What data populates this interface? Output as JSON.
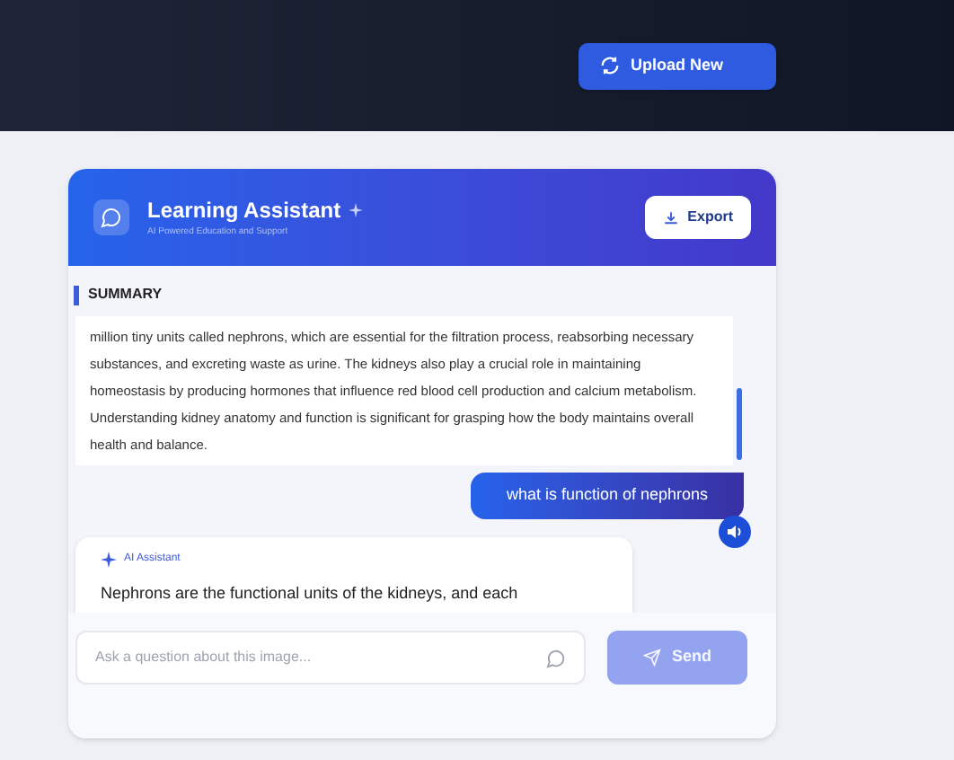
{
  "top_bar": {
    "upload_button": "Upload New"
  },
  "assistant": {
    "title": "Learning Assistant",
    "subtitle": "AI Powered Education and Support",
    "export_button": "Export"
  },
  "summary": {
    "heading": "SUMMARY",
    "text": "million tiny units called nephrons, which are essential for the filtration process, reabsorbing necessary substances, and excreting waste as urine. The kidneys also play a crucial role in maintaining homeostasis by producing hormones that influence red blood cell production and calcium metabolism. Understanding kidney anatomy and function is significant for grasping how the body maintains overall health and balance."
  },
  "messages": [
    {
      "kind": "user",
      "text": "what is function of nephrons"
    },
    {
      "kind": "assistant",
      "sender": "AI Assistant",
      "text": "Nephrons are the functional units of the kidneys, and each"
    }
  ],
  "composer": {
    "placeholder": "Ask a question about this image...",
    "send_button": "Send",
    "disabled": true
  }
}
